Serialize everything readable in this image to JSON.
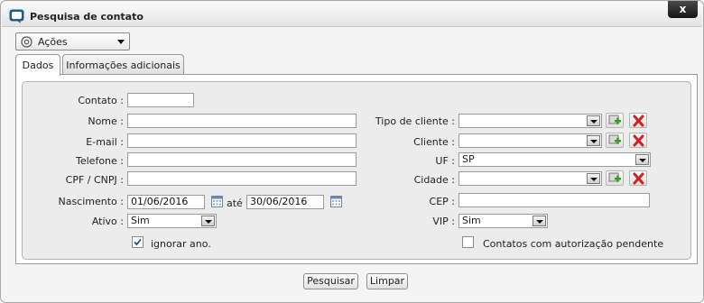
{
  "window": {
    "title": "Pesquisa de contato",
    "close_label": "x"
  },
  "actions_menu": {
    "label": "Ações"
  },
  "tabs": [
    {
      "label": "Dados"
    },
    {
      "label": "Informações adicionais"
    }
  ],
  "form": {
    "contato": {
      "label": "Contato :",
      "value": ""
    },
    "nome": {
      "label": "Nome :",
      "value": ""
    },
    "email": {
      "label": "E-mail :",
      "value": ""
    },
    "telefone": {
      "label": "Telefone :",
      "value": ""
    },
    "cpf": {
      "label": "CPF / CNPJ :",
      "value": ""
    },
    "nascimento": {
      "label": "Nascimento :",
      "from": "01/06/2016",
      "ate_label": "até",
      "to": "30/06/2016"
    },
    "ativo": {
      "label": "Ativo :",
      "value": "Sim"
    },
    "ignorar_ano": {
      "label": "ignorar ano.",
      "checked": true
    },
    "tipo_cliente": {
      "label": "Tipo de cliente :",
      "value": ""
    },
    "cliente": {
      "label": "Cliente :",
      "value": ""
    },
    "uf": {
      "label": "UF :",
      "value": "SP"
    },
    "cidade": {
      "label": "Cidade :",
      "value": ""
    },
    "cep": {
      "label": "CEP :",
      "value": ""
    },
    "vip": {
      "label": "VIP :",
      "value": "Sim"
    },
    "autorizacao": {
      "label": "Contatos com autorização pendente",
      "checked": false
    }
  },
  "buttons": {
    "search": "Pesquisar",
    "clear": "Limpar"
  },
  "colors": {
    "add_icon": "#3a9a2a",
    "remove_icon": "#d42020",
    "titlebar": "#e3e3e3"
  }
}
